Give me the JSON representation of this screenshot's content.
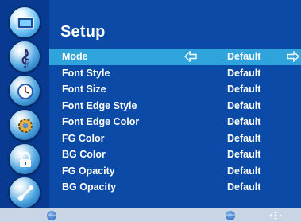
{
  "title": "Setup",
  "menu": {
    "rows": [
      {
        "label": "Mode",
        "value": "Default",
        "selected": true
      },
      {
        "label": "Font Style",
        "value": "Default",
        "selected": false
      },
      {
        "label": "Font Size",
        "value": "Default",
        "selected": false
      },
      {
        "label": "Font Edge Style",
        "value": "Default",
        "selected": false
      },
      {
        "label": "Font Edge Color",
        "value": "Default",
        "selected": false
      },
      {
        "label": "FG Color",
        "value": "Default",
        "selected": false
      },
      {
        "label": "BG Color",
        "value": "Default",
        "selected": false
      },
      {
        "label": "FG Opacity",
        "value": "Default",
        "selected": false
      },
      {
        "label": "BG Opacity",
        "value": "Default",
        "selected": false
      }
    ]
  },
  "sidebar": {
    "items": [
      {
        "icon": "picture-icon",
        "active": true
      },
      {
        "icon": "sound-note-icon",
        "active": false
      },
      {
        "icon": "clock-icon",
        "active": false
      },
      {
        "icon": "settings-gear-icon",
        "active": false
      },
      {
        "icon": "lock-icon",
        "active": false
      },
      {
        "icon": "satellite-icon",
        "active": false
      }
    ]
  },
  "footer": {
    "menu_hint": "MENU",
    "enter_hint": "ENTER",
    "nav_icon": "arrows-nav-icon"
  },
  "colors": {
    "background": "#0b4aa6",
    "sidebar": "#073a90",
    "highlight": "#2ea3dc",
    "footer": "#c9d4e4",
    "text": "#ffffff"
  }
}
